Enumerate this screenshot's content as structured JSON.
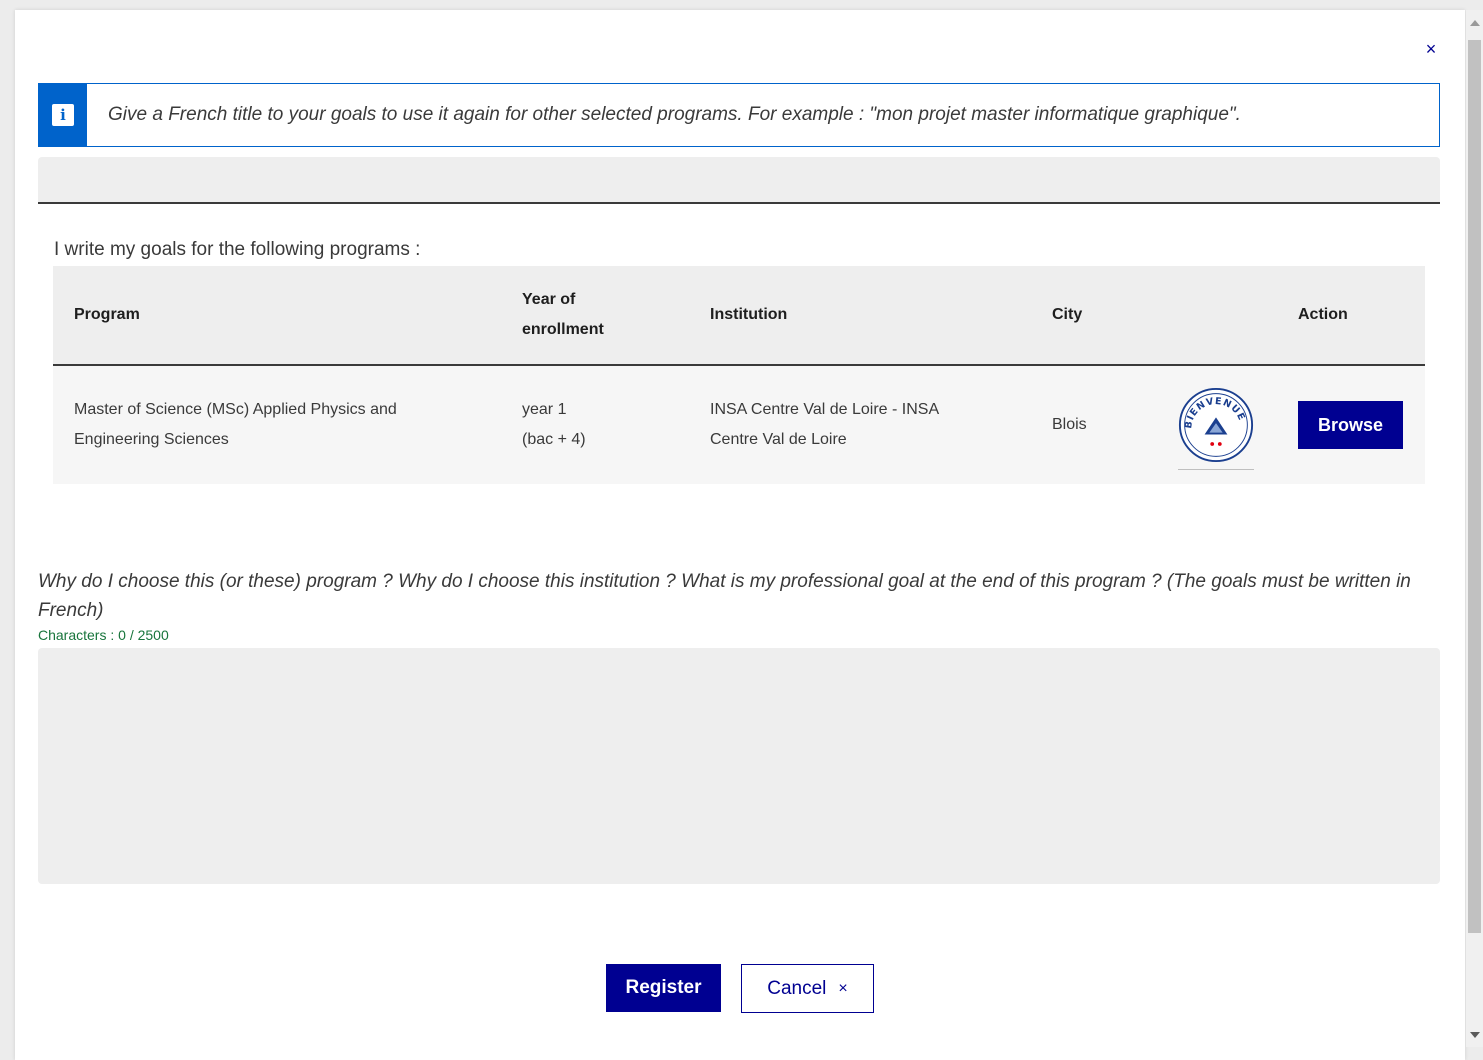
{
  "dialog": {
    "close_glyph": "×",
    "info_icon": "info-icon",
    "info_glyph": "i",
    "info_text": "Give a French title to your goals to use it again for other selected programs. For example : \"mon projet master informatique graphique\".",
    "title_value": ""
  },
  "programs": {
    "label": "I write my goals for the following programs :",
    "headers": {
      "program": "Program",
      "year_line1": "Year of",
      "year_line2": "enrollment",
      "institution": "Institution",
      "city": "City",
      "action": "Action"
    },
    "rows": [
      {
        "program_line1": "Master of Science (MSc) Applied Physics and",
        "program_line2": "Engineering Sciences",
        "year_line1": "year 1",
        "year_line2": "(bac + 4)",
        "institution_line1": "INSA Centre Val de Loire - INSA",
        "institution_line2": "Centre Val de Loire",
        "city": "Blois",
        "badge_text": "BIENVENUE EN FRANCE",
        "action_label": "Browse"
      }
    ]
  },
  "goals": {
    "question": "Why do I choose this (or these) program ? Why do I choose this institution ? What is my professional goal at the end of this program ? (The goals must be written in French)",
    "char_count": "Characters : 0 / 2500",
    "value": ""
  },
  "footer": {
    "register_label": "Register",
    "cancel_label": "Cancel",
    "cancel_glyph": "×"
  },
  "colors": {
    "primary": "#000091",
    "info_blue": "#0063cb",
    "success_green": "#18753c",
    "field_bg": "#eeeeee"
  }
}
